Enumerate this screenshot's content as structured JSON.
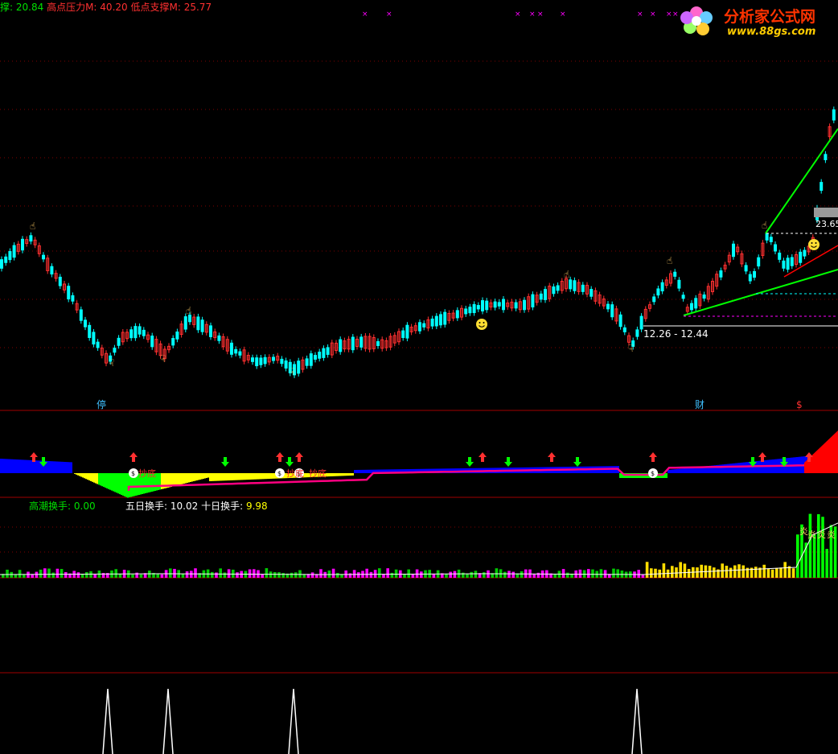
{
  "header": {
    "support_label": "撑",
    "support_value": "20.84",
    "high_pressure_label": "高点压力M:",
    "high_pressure_value": "40.20",
    "low_support_label": "低点支撑M:",
    "low_support_value": "25.77"
  },
  "watermark": {
    "brand": "分析家公式网",
    "url": "www.88gs.com"
  },
  "main_chart": {
    "price_tag": "23.65",
    "range_label": "12.26 - 12.44",
    "marker_stop": "停",
    "marker_cai": "财",
    "marker_dollar": "$"
  },
  "indicator_chart": {
    "label_chaodi": "抄底"
  },
  "turnover_panel": {
    "high_tide_label": "高潮换手:",
    "high_tide_value": "0.00",
    "five_day_label": "五日换手:",
    "five_day_value": "10.02",
    "ten_day_label": "十日换手:",
    "ten_day_value": "9.98"
  },
  "colors": {
    "up": "#ff3030",
    "down": "#00ffff",
    "grid": "#800000",
    "trend_green": "#00ff00",
    "trend_red": "#ff0000"
  }
}
